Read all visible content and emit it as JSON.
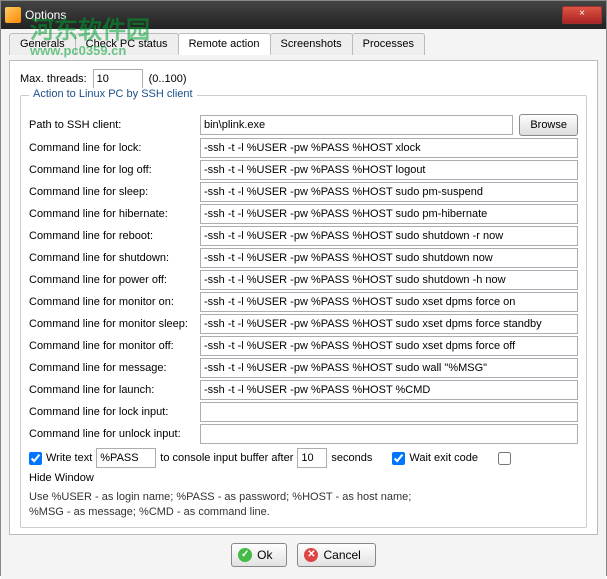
{
  "window": {
    "title": "Options",
    "close": "×"
  },
  "watermark": {
    "line1": "河东软件园",
    "line2": "www.pc0359.cn"
  },
  "tabs": {
    "generals": "Generals",
    "check_pc_status": "Check PC status",
    "remote_action": "Remote action",
    "screenshots": "Screenshots",
    "processes": "Processes"
  },
  "threads": {
    "label": "Max. threads:",
    "value": "10",
    "range": "(0..100)"
  },
  "group": {
    "legend": "Action to Linux PC by SSH client",
    "path_label": "Path to SSH client:",
    "path_value": "bin\\plink.exe",
    "browse": "Browse",
    "rows": [
      {
        "label": "Command line for lock:",
        "value": "-ssh -t -l %USER -pw %PASS %HOST xlock"
      },
      {
        "label": "Command line for log off:",
        "value": "-ssh -t -l %USER -pw %PASS %HOST logout"
      },
      {
        "label": "Command line for sleep:",
        "value": "-ssh -t -l %USER -pw %PASS %HOST sudo pm-suspend"
      },
      {
        "label": "Command line for hibernate:",
        "value": "-ssh -t -l %USER -pw %PASS %HOST sudo pm-hibernate"
      },
      {
        "label": "Command line for reboot:",
        "value": "-ssh -t -l %USER -pw %PASS %HOST sudo shutdown -r now"
      },
      {
        "label": "Command line for shutdown:",
        "value": "-ssh -t -l %USER -pw %PASS %HOST sudo shutdown now"
      },
      {
        "label": "Command line for power off:",
        "value": "-ssh -t -l %USER -pw %PASS %HOST sudo shutdown -h now"
      },
      {
        "label": "Command line for monitor on:",
        "value": "-ssh -t -l %USER -pw %PASS %HOST sudo xset dpms force on"
      },
      {
        "label": "Command line for monitor sleep:",
        "value": "-ssh -t -l %USER -pw %PASS %HOST sudo xset dpms force standby"
      },
      {
        "label": "Command line for monitor off:",
        "value": "-ssh -t -l %USER -pw %PASS %HOST sudo xset dpms force off"
      },
      {
        "label": "Command line for message:",
        "value": "-ssh -t -l %USER -pw %PASS %HOST sudo wall \"%MSG\""
      },
      {
        "label": "Command line for launch:",
        "value": "-ssh -t -l %USER -pw %PASS %HOST %CMD"
      },
      {
        "label": "Command line for lock input:",
        "value": ""
      },
      {
        "label": "Command line for unlock input:",
        "value": ""
      }
    ],
    "write_text_label": "Write text",
    "write_text_value": "%PASS",
    "write_text_after": "to console input buffer after",
    "write_text_secs": "10",
    "write_text_seconds": "seconds",
    "wait_exit": "Wait exit code",
    "hide_window": "Hide Window",
    "hint": "Use %USER - as login name; %PASS - as password; %HOST - as host name;\n%MSG - as message; %CMD - as command line."
  },
  "buttons": {
    "ok": "Ok",
    "cancel": "Cancel"
  }
}
